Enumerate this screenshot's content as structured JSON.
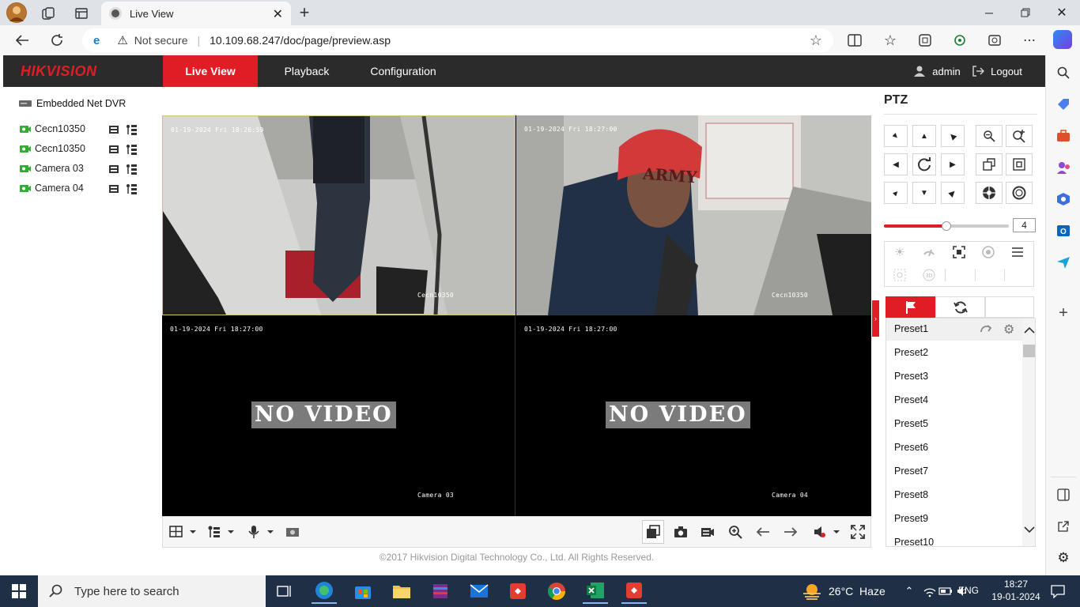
{
  "browser": {
    "tab_title": "Live View",
    "security_label": "Not secure",
    "url": "10.109.68.247/doc/page/preview.asp"
  },
  "app": {
    "logo": "HIKVISION",
    "nav": {
      "live_view": "Live View",
      "playback": "Playback",
      "configuration": "Configuration"
    },
    "user": "admin",
    "logout": "Logout",
    "accent_color": "#e01d25"
  },
  "device_tree": {
    "root": "Embedded Net DVR",
    "cameras": [
      "Cecn10350",
      "Cecn10350",
      "Camera 03",
      "Camera 04"
    ]
  },
  "video": {
    "tiles": [
      {
        "timestamp": "01-19-2024 Fri 18:26:59",
        "label": "Cecn10350",
        "state": "live",
        "selected": true
      },
      {
        "timestamp": "01-19-2024 Fri 18:27:00",
        "label": "Cecn10350",
        "state": "live",
        "selected": false
      },
      {
        "timestamp": "01-19-2024 Fri 18:27:00",
        "label": "Camera 03",
        "state": "NO VIDEO",
        "selected": false
      },
      {
        "timestamp": "01-19-2024 Fri 18:27:00",
        "label": "Camera 04",
        "state": "NO VIDEO",
        "selected": false
      }
    ],
    "hat_text": "ARMY"
  },
  "footer": "©2017 Hikvision Digital Technology Co., Ltd. All Rights Reserved.",
  "ptz": {
    "title": "PTZ",
    "speed": "4",
    "speed_fraction": 0.5,
    "presets": [
      "Preset1",
      "Preset2",
      "Preset3",
      "Preset4",
      "Preset5",
      "Preset6",
      "Preset7",
      "Preset8",
      "Preset9",
      "Preset10"
    ]
  },
  "taskbar": {
    "search_placeholder": "Type here to search",
    "weather": "26°C  Haze",
    "language": "ENG",
    "time": "18:27",
    "date": "19-01-2024"
  }
}
